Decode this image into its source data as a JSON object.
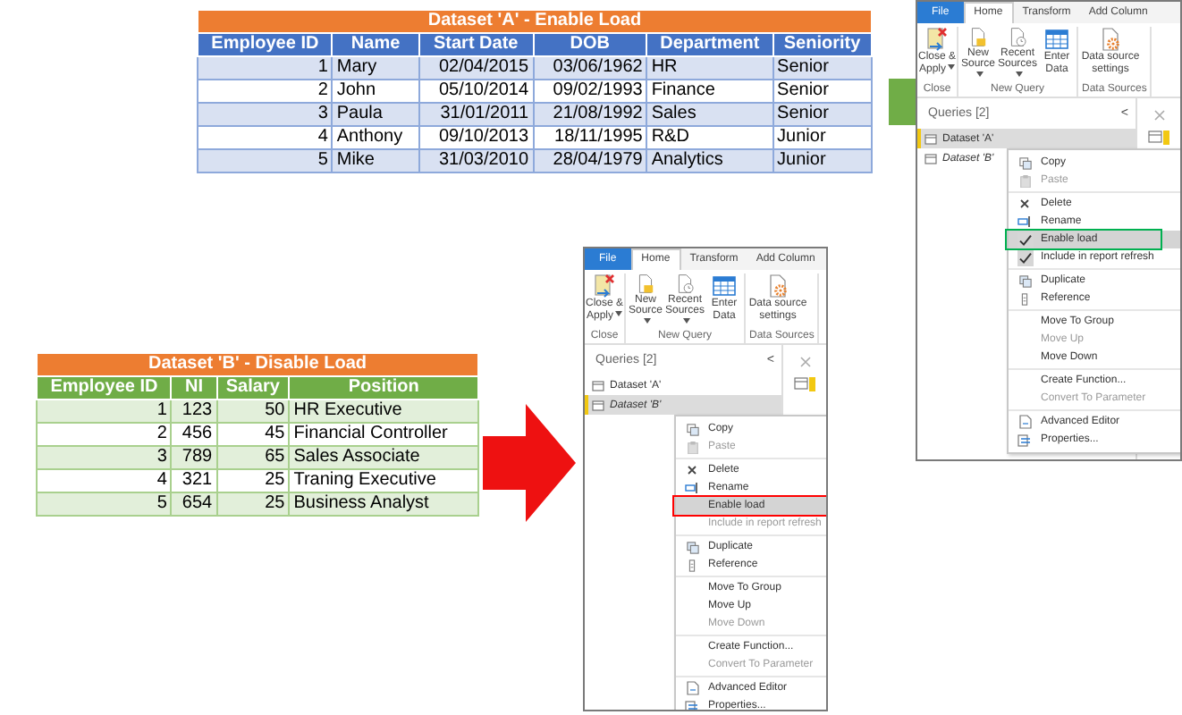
{
  "table_a": {
    "title": "Dataset 'A' - Enable Load",
    "columns": [
      {
        "label": "Employee ID",
        "numeric": true
      },
      {
        "label": "Name",
        "numeric": false
      },
      {
        "label": "Start Date",
        "numeric": true
      },
      {
        "label": "DOB",
        "numeric": true
      },
      {
        "label": "Department",
        "numeric": false
      },
      {
        "label": "Seniority",
        "numeric": false
      }
    ],
    "rows": [
      [
        "1",
        "Mary",
        "02/04/2015",
        "03/06/1962",
        "HR",
        "Senior"
      ],
      [
        "2",
        "John",
        "05/10/2014",
        "09/02/1993",
        "Finance",
        "Senior"
      ],
      [
        "3",
        "Paula",
        "31/01/2011",
        "21/08/1992",
        "Sales",
        "Senior"
      ],
      [
        "4",
        "Anthony",
        "09/10/2013",
        "18/11/1995",
        "R&D",
        "Junior"
      ],
      [
        "5",
        "Mike",
        "31/03/2010",
        "28/04/1979",
        "Analytics",
        "Junior"
      ]
    ]
  },
  "editor_a": {
    "tabs": [
      {
        "label": "File",
        "kind": "file",
        "selected": false
      },
      {
        "label": "Home",
        "kind": "tab",
        "selected": true
      },
      {
        "label": "Transform",
        "kind": "tab",
        "selected": false
      },
      {
        "label": "Add Column",
        "kind": "tab",
        "selected": false
      }
    ],
    "groups": [
      {
        "label": "Close",
        "buttons": [
          {
            "label": "Close & Apply",
            "kind": "close-apply",
            "dropdown": true
          }
        ]
      },
      {
        "label": "New Query",
        "buttons": [
          {
            "label": "New Source",
            "kind": "new-source",
            "dropdown": true
          },
          {
            "label": "Recent Sources",
            "kind": "recent",
            "dropdown": true
          },
          {
            "label": "Enter Data",
            "kind": "enter-data",
            "dropdown": false
          }
        ]
      },
      {
        "label": "Data Sources",
        "buttons": [
          {
            "label": "Data source settings",
            "kind": "settings",
            "dropdown": false
          }
        ]
      }
    ],
    "queries_title": "Queries [2]",
    "collapse": "<",
    "queries": [
      {
        "label": "Dataset 'A'",
        "selected": true,
        "load_disabled": false
      },
      {
        "label": "Dataset 'B'",
        "selected": false,
        "load_disabled": true
      }
    ],
    "menu": [
      [
        {
          "label": "Copy",
          "kind": "copy",
          "disabled": false
        },
        {
          "label": "Paste",
          "kind": "paste",
          "disabled": true
        }
      ],
      [
        {
          "label": "Delete",
          "kind": "delete",
          "disabled": false
        },
        {
          "label": "Rename",
          "kind": "rename",
          "disabled": false
        },
        {
          "label": "Enable load",
          "kind": "toggle",
          "disabled": false,
          "checked": true,
          "highlighted": true,
          "color": "#00b050"
        },
        {
          "label": "Include in report refresh",
          "kind": "toggle",
          "disabled": false,
          "checked": true,
          "highlighted": false
        }
      ],
      [
        {
          "label": "Duplicate",
          "kind": "duplicate",
          "disabled": false
        },
        {
          "label": "Reference",
          "kind": "reference",
          "disabled": false
        }
      ],
      [
        {
          "label": "Move To Group",
          "kind": "plain",
          "disabled": false
        },
        {
          "label": "Move Up",
          "kind": "plain",
          "disabled": true
        },
        {
          "label": "Move Down",
          "kind": "plain",
          "disabled": false
        }
      ],
      [
        {
          "label": "Create Function...",
          "kind": "plain",
          "disabled": false
        },
        {
          "label": "Convert To Parameter",
          "kind": "plain",
          "disabled": true
        }
      ],
      [
        {
          "label": "Advanced Editor",
          "kind": "editor",
          "disabled": false
        },
        {
          "label": "Properties...",
          "kind": "properties",
          "disabled": false
        }
      ]
    ]
  },
  "table_b": {
    "title": "Dataset 'B' - Disable Load",
    "columns": [
      {
        "label": "Employee ID",
        "numeric": true
      },
      {
        "label": "NI",
        "numeric": true
      },
      {
        "label": "Salary",
        "numeric": true
      },
      {
        "label": "Position",
        "numeric": false
      }
    ],
    "rows": [
      [
        "1",
        "123",
        "50",
        "HR Executive"
      ],
      [
        "2",
        "456",
        "45",
        "Financial Controller"
      ],
      [
        "3",
        "789",
        "65",
        "Sales Associate"
      ],
      [
        "4",
        "321",
        "25",
        "Traning Executive"
      ],
      [
        "5",
        "654",
        "25",
        "Business Analyst"
      ]
    ]
  },
  "editor_b": {
    "tabs": [
      {
        "label": "File",
        "kind": "file",
        "selected": false
      },
      {
        "label": "Home",
        "kind": "tab",
        "selected": true
      },
      {
        "label": "Transform",
        "kind": "tab",
        "selected": false
      },
      {
        "label": "Add Column",
        "kind": "tab",
        "selected": false
      }
    ],
    "groups": [
      {
        "label": "Close",
        "buttons": [
          {
            "label": "Close & Apply",
            "kind": "close-apply",
            "dropdown": true
          }
        ]
      },
      {
        "label": "New Query",
        "buttons": [
          {
            "label": "New Source",
            "kind": "new-source",
            "dropdown": true
          },
          {
            "label": "Recent Sources",
            "kind": "recent",
            "dropdown": true
          },
          {
            "label": "Enter Data",
            "kind": "enter-data",
            "dropdown": false
          }
        ]
      },
      {
        "label": "Data Sources",
        "buttons": [
          {
            "label": "Data source settings",
            "kind": "settings",
            "dropdown": false
          }
        ]
      }
    ],
    "queries_title": "Queries [2]",
    "collapse": "<",
    "queries": [
      {
        "label": "Dataset 'A'",
        "selected": false,
        "load_disabled": false
      },
      {
        "label": "Dataset 'B'",
        "selected": true,
        "load_disabled": true
      }
    ],
    "menu": [
      [
        {
          "label": "Copy",
          "kind": "copy",
          "disabled": false
        },
        {
          "label": "Paste",
          "kind": "paste",
          "disabled": true
        }
      ],
      [
        {
          "label": "Delete",
          "kind": "delete",
          "disabled": false
        },
        {
          "label": "Rename",
          "kind": "rename",
          "disabled": false
        },
        {
          "label": "Enable load",
          "kind": "toggle",
          "disabled": false,
          "checked": false,
          "highlighted": true,
          "color": "#ff0000"
        },
        {
          "label": "Include in report refresh",
          "kind": "toggle",
          "disabled": true,
          "checked": false,
          "highlighted": false
        }
      ],
      [
        {
          "label": "Duplicate",
          "kind": "duplicate",
          "disabled": false
        },
        {
          "label": "Reference",
          "kind": "reference",
          "disabled": false
        }
      ],
      [
        {
          "label": "Move To Group",
          "kind": "plain",
          "disabled": false
        },
        {
          "label": "Move Up",
          "kind": "plain",
          "disabled": false
        },
        {
          "label": "Move Down",
          "kind": "plain",
          "disabled": true
        }
      ],
      [
        {
          "label": "Create Function...",
          "kind": "plain",
          "disabled": false
        },
        {
          "label": "Convert To Parameter",
          "kind": "plain",
          "disabled": true
        }
      ],
      [
        {
          "label": "Advanced Editor",
          "kind": "editor",
          "disabled": false
        },
        {
          "label": "Properties...",
          "kind": "properties",
          "disabled": false
        }
      ]
    ]
  }
}
